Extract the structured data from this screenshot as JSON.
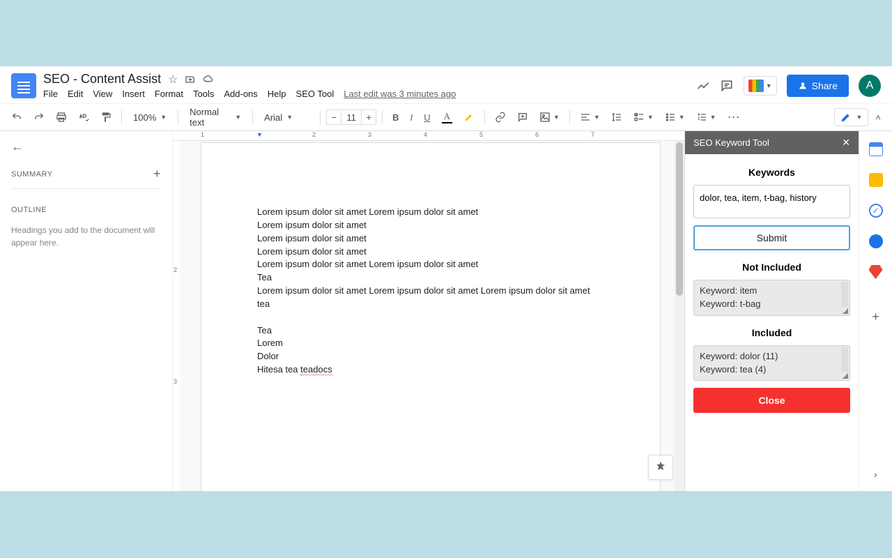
{
  "header": {
    "doc_title": "SEO - Content Assist",
    "avatar_initial": "A",
    "share_label": "Share",
    "last_edit": "Last edit was 3 minutes ago"
  },
  "menus": {
    "file": "File",
    "edit": "Edit",
    "view": "View",
    "insert": "Insert",
    "format": "Format",
    "tools": "Tools",
    "addons": "Add-ons",
    "help": "Help",
    "seo_tool": "SEO Tool"
  },
  "toolbar": {
    "zoom": "100%",
    "style": "Normal text",
    "font": "Arial",
    "font_size": "11"
  },
  "outline": {
    "summary_label": "SUMMARY",
    "outline_label": "OUTLINE",
    "hint": "Headings you add to the document will appear here."
  },
  "document": {
    "lines": [
      "Lorem ipsum dolor sit amet Lorem ipsum dolor sit amet",
      "Lorem ipsum dolor sit amet",
      "Lorem ipsum dolor sit amet",
      "Lorem ipsum dolor sit amet",
      "Lorem ipsum dolor sit amet Lorem ipsum dolor sit amet",
      "Tea",
      "Lorem ipsum dolor sit amet Lorem ipsum dolor sit amet Lorem ipsum dolor sit amet tea",
      "",
      "Tea",
      "Lorem",
      "Dolor"
    ],
    "last_line_pre": "Hitesa tea ",
    "last_line_spell": "teadocs"
  },
  "ruler": {
    "m1": "1",
    "m2": "2",
    "m3": "3",
    "m4": "4",
    "m5": "5",
    "m6": "6",
    "m7": "7",
    "v2": "2",
    "v3": "3"
  },
  "seo": {
    "panel_title": "SEO Keyword Tool",
    "h_keywords": "Keywords",
    "input_value": "dolor, tea, item, t-bag, history",
    "submit_label": "Submit",
    "h_not_included": "Not Included",
    "not_included": [
      "Keyword: item",
      "Keyword: t-bag"
    ],
    "h_included": "Included",
    "included": [
      "Keyword: dolor (11)",
      "Keyword: tea (4)"
    ],
    "close_label": "Close"
  }
}
